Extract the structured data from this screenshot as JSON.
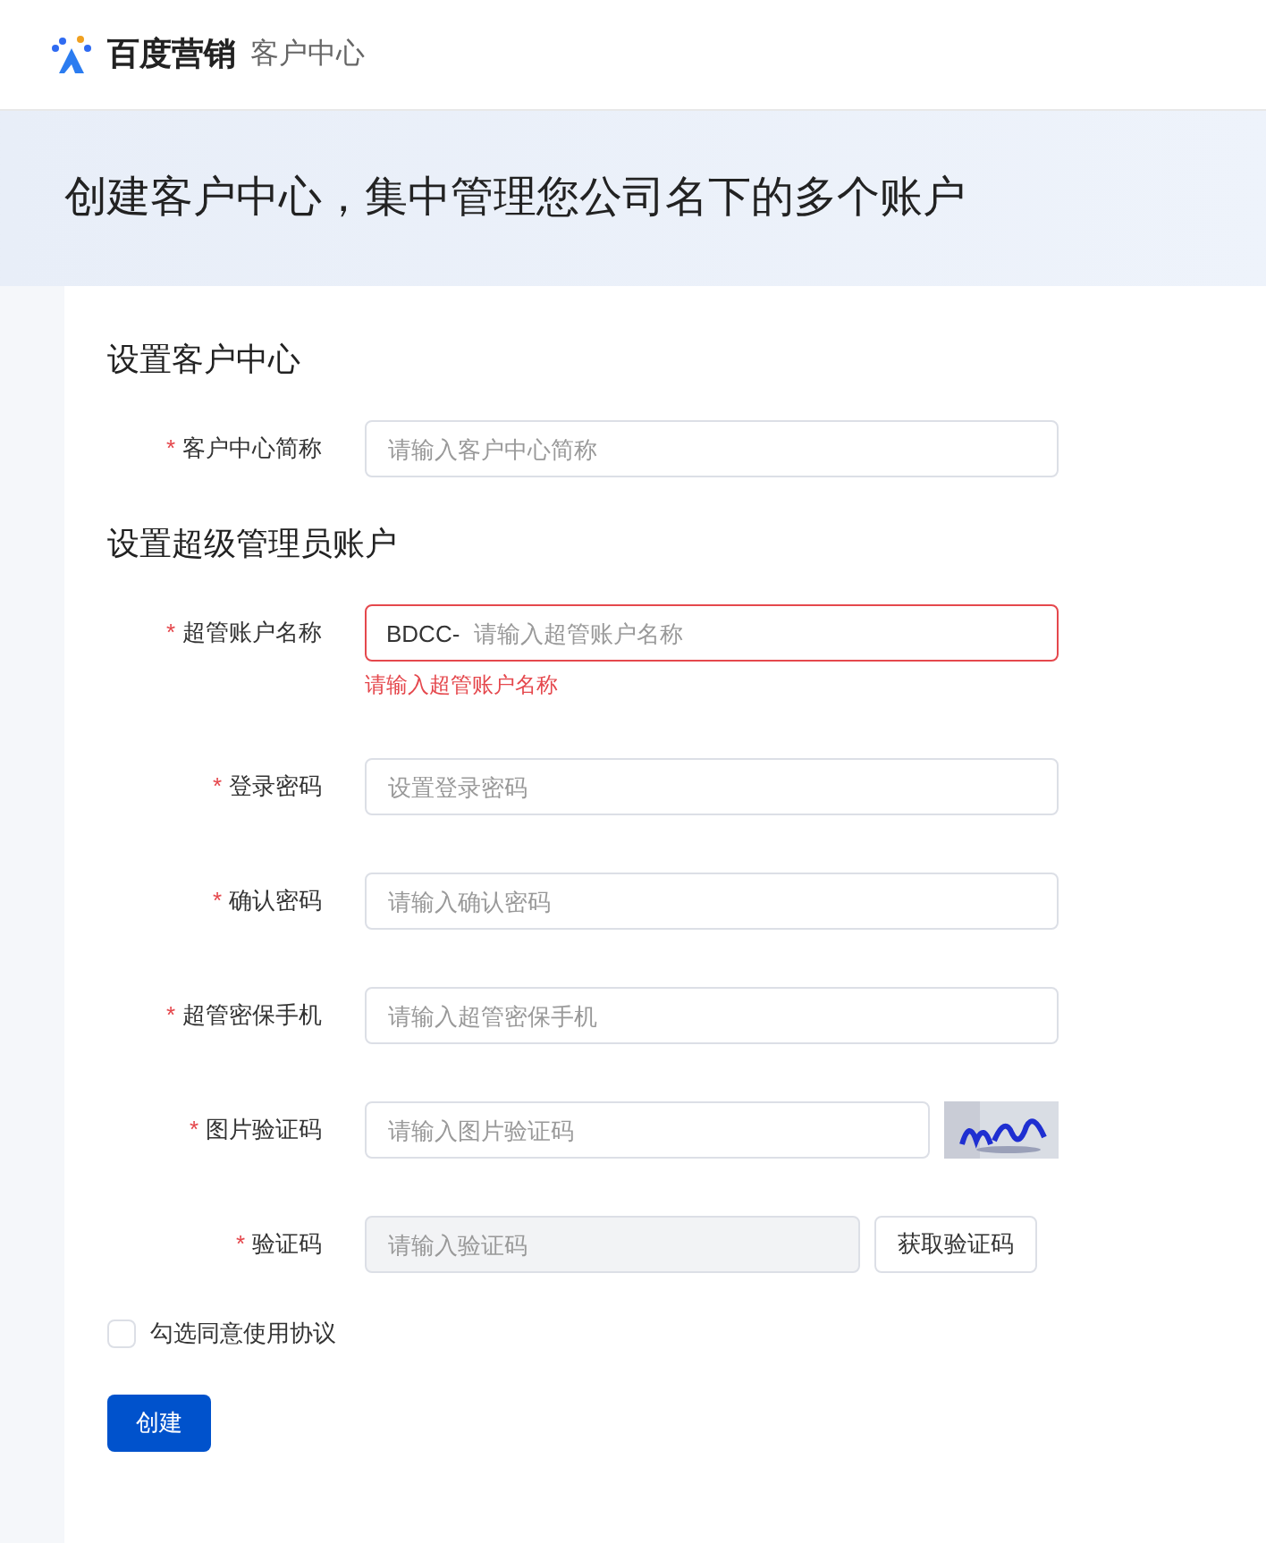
{
  "header": {
    "logo_text": "百度营销",
    "product": "客户中心"
  },
  "banner": {
    "title": "创建客户中心，集中管理您公司名下的多个账户"
  },
  "sections": [
    {
      "title": "设置客户中心",
      "fields": [
        {
          "kind": "input",
          "label": "客户中心简称",
          "required_mark": "*",
          "placeholder": "请输入客户中心简称"
        }
      ]
    },
    {
      "title": "设置超级管理员账户",
      "fields": [
        {
          "kind": "prefixed",
          "label": "超管账户名称",
          "required_mark": "*",
          "prefix": "BDCC-",
          "placeholder": "请输入超管账户名称",
          "error": "请输入超管账户名称"
        },
        {
          "kind": "input",
          "label": "登录密码",
          "required_mark": "*",
          "placeholder": "设置登录密码"
        },
        {
          "kind": "input",
          "label": "确认密码",
          "required_mark": "*",
          "placeholder": "请输入确认密码"
        },
        {
          "kind": "input",
          "label": "超管密保手机",
          "required_mark": "*",
          "placeholder": "请输入超管密保手机"
        },
        {
          "kind": "captcha",
          "label": "图片验证码",
          "required_mark": "*",
          "placeholder": "请输入图片验证码"
        },
        {
          "kind": "sms",
          "label": "验证码",
          "required_mark": "*",
          "placeholder": "请输入验证码",
          "disabled": true,
          "button": "获取验证码"
        }
      ]
    }
  ],
  "agreement": {
    "label": "勾选同意使用协议",
    "checked": false
  },
  "submit": "创建"
}
